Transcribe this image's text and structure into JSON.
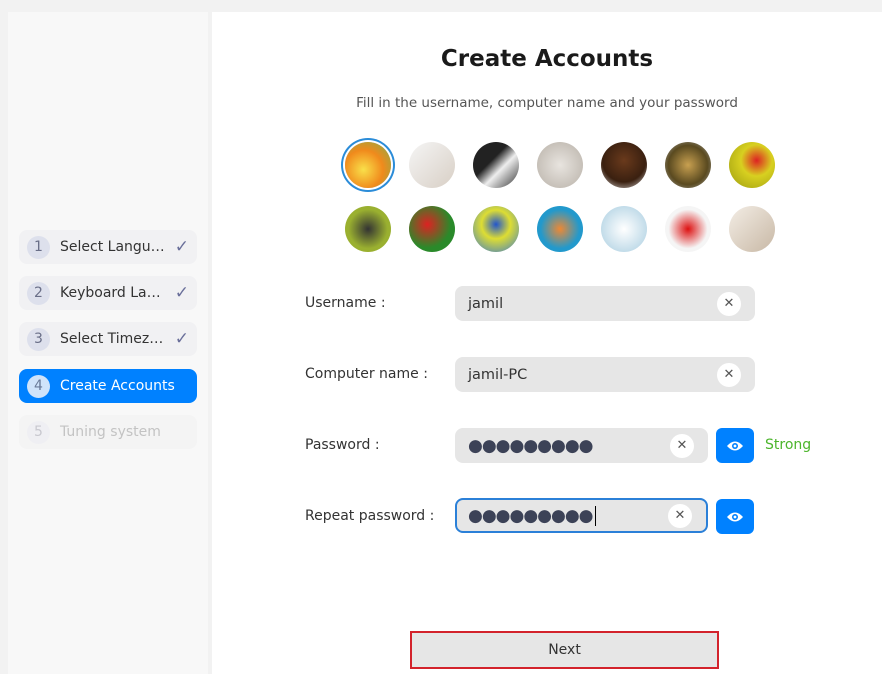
{
  "sidebar": {
    "steps": [
      {
        "num": "1",
        "label": "Select Langu…",
        "done": true
      },
      {
        "num": "2",
        "label": "Keyboard La…",
        "done": true
      },
      {
        "num": "3",
        "label": "Select Timez…",
        "done": true
      },
      {
        "num": "4",
        "label": "Create Accounts",
        "active": true
      },
      {
        "num": "5",
        "label": "Tuning system",
        "disabled": true
      }
    ]
  },
  "main": {
    "title": "Create Accounts",
    "subtitle": "Fill in the username, computer name and your password",
    "avatars": [
      "flower",
      "calendar",
      "piano",
      "kitten",
      "horse",
      "leopard",
      "ladybug",
      "butterfly",
      "parrot",
      "hot-air-balloon",
      "balloons",
      "shell",
      "heart",
      "room"
    ],
    "username": {
      "label": "Username :",
      "value": "jamil"
    },
    "computer": {
      "label": "Computer name :",
      "value": "jamil-PC"
    },
    "password": {
      "label": "Password :",
      "value": "●●●●●●●●●",
      "strength": "Strong"
    },
    "repeat": {
      "label": "Repeat password :",
      "value": "●●●●●●●●●"
    },
    "next": "Next"
  },
  "colors": {
    "accent": "#0081ff",
    "strong": "#4cb52c",
    "highlight": "#d3232c"
  }
}
